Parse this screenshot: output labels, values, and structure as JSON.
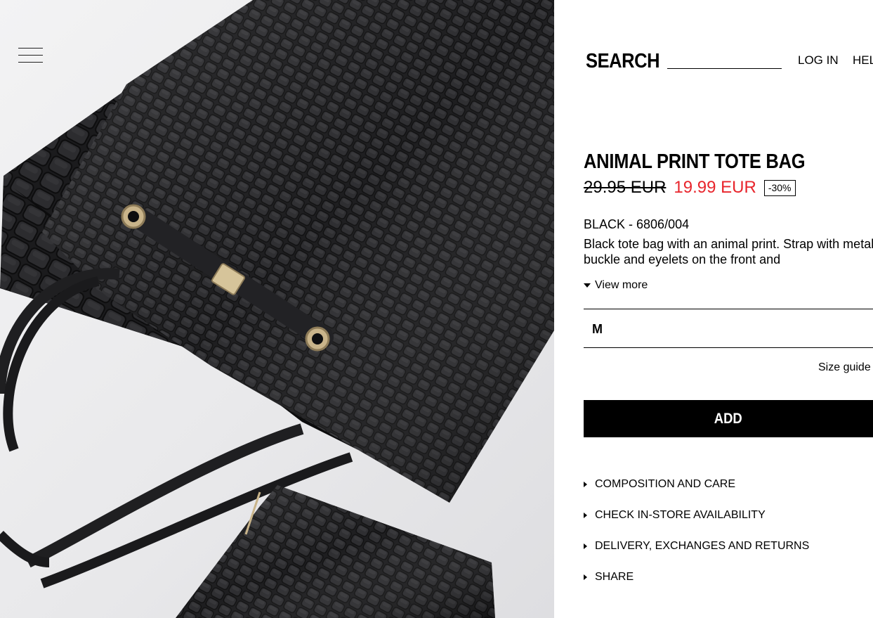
{
  "header": {
    "search_label": "SEARCH",
    "search_value": "",
    "login_label": "LOG IN",
    "help_label": "HEL"
  },
  "product": {
    "title": "ANIMAL PRINT TOTE BAG",
    "old_price": "29.95 EUR",
    "new_price": "19.99 EUR",
    "discount": "-30%",
    "color_ref": "BLACK - 6806/004",
    "description": "Black tote bag with an animal print. Strap with metal buckle and eyelets on the front and",
    "view_more_label": "View more",
    "selected_size": "M",
    "size_guide_label": "Size guide",
    "add_label": "ADD"
  },
  "accordion": [
    {
      "label": "COMPOSITION AND CARE"
    },
    {
      "label": "CHECK IN-STORE AVAILABILITY"
    },
    {
      "label": "DELIVERY, EXCHANGES AND RETURNS"
    },
    {
      "label": "SHARE"
    }
  ],
  "colors": {
    "sale_red": "#e8252c",
    "black": "#000000",
    "bag_leather": "#1c1c1e"
  }
}
